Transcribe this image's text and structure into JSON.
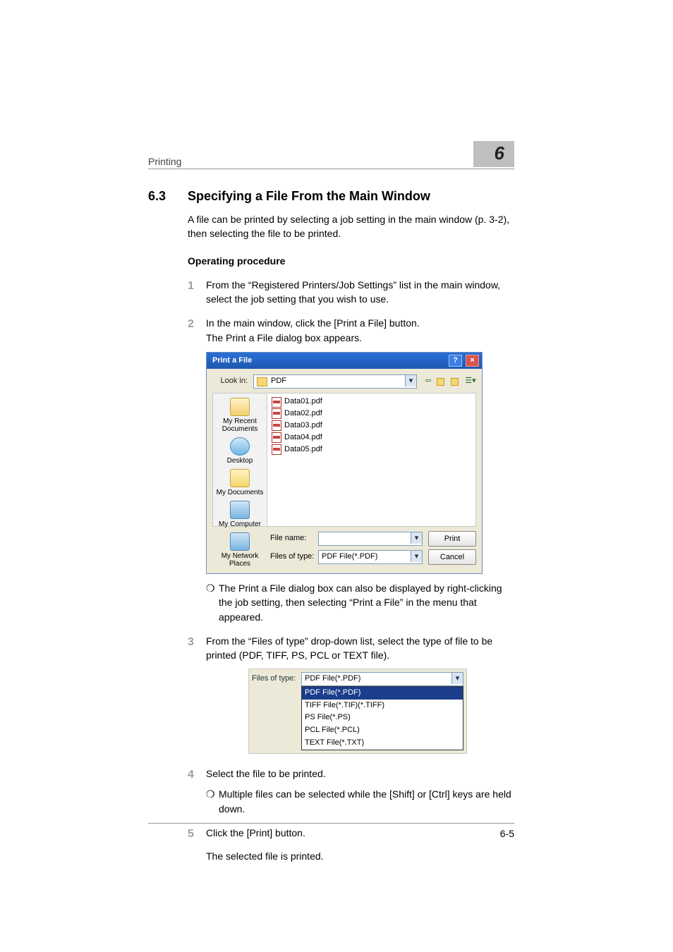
{
  "header": {
    "running": "Printing",
    "chapter": "6"
  },
  "section": {
    "num": "6.3",
    "title": "Specifying a File From the Main Window"
  },
  "intro": "A file can be printed by selecting a job setting in the main window (p. 3-2), then selecting the file to be printed.",
  "op_heading": "Operating procedure",
  "steps": {
    "s1": {
      "num": "1",
      "text": "From the “Registered Printers/Job Settings” list in the main window, select the job setting that you wish to use."
    },
    "s2": {
      "num": "2",
      "line1": "In the main window, click the [Print a File] button.",
      "line2": "The Print a File dialog box appears."
    },
    "s2_bullet": "The Print a File dialog box can also be displayed by right-clicking the job setting, then selecting “Print a File” in the menu that appeared.",
    "s3": {
      "num": "3",
      "text": "From the “Files of type” drop-down list, select the type of file to be printed (PDF, TIFF, PS, PCL or TEXT file)."
    },
    "s4": {
      "num": "4",
      "text": "Select the file to be printed."
    },
    "s4_bullet": "Multiple files can be selected while the [Shift] or [Ctrl] keys are held down.",
    "s5": {
      "num": "5",
      "text": "Click the [Print] button."
    },
    "s5_after": "The selected file is printed."
  },
  "dialog": {
    "title": "Print a File",
    "help": "?",
    "close": "×",
    "lookin_label": "Look in:",
    "lookin_value": "PDF",
    "places": {
      "recent": "My Recent Documents",
      "desktop": "Desktop",
      "docs": "My Documents",
      "comp": "My Computer",
      "net": "My Network Places"
    },
    "files": [
      "Data01.pdf",
      "Data02.pdf",
      "Data03.pdf",
      "Data04.pdf",
      "Data05.pdf"
    ],
    "filename_label": "File name:",
    "filetype_label": "Files of type:",
    "filetype_value": "PDF File(*.PDF)",
    "print_btn": "Print",
    "cancel_btn": "Cancel"
  },
  "dropdown": {
    "label": "Files of type:",
    "selected": "PDF File(*.PDF)",
    "options": [
      "PDF File(*.PDF)",
      "TIFF File(*.TIF)(*.TIFF)",
      "PS File(*.PS)",
      "PCL File(*.PCL)",
      "TEXT File(*.TXT)"
    ]
  },
  "footer": {
    "page": "6-5"
  },
  "glyphs": {
    "dropdown_arrow": "▾",
    "bullet": "❍",
    "back": "⇦",
    "up": "↑"
  }
}
